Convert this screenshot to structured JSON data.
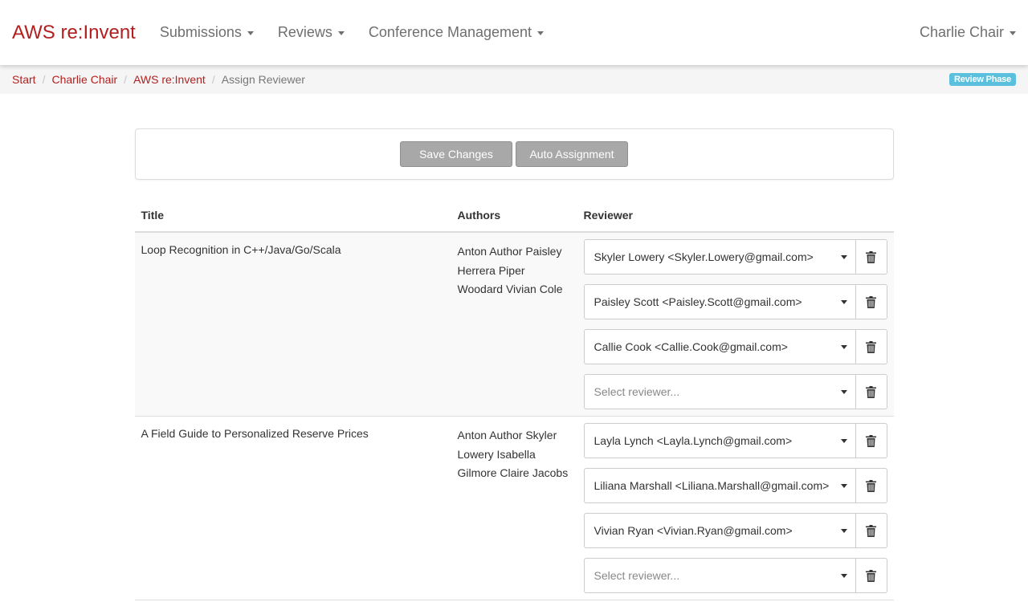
{
  "navbar": {
    "brand": "AWS re:Invent",
    "menus": [
      "Submissions",
      "Reviews",
      "Conference Management"
    ],
    "user": "Charlie Chair"
  },
  "breadcrumb": {
    "items": [
      "Start",
      "Charlie Chair",
      "AWS re:Invent"
    ],
    "active": "Assign Reviewer",
    "phase_badge": "Review Phase"
  },
  "toolbar": {
    "save_label": "Save Changes",
    "auto_label": "Auto Assignment"
  },
  "table": {
    "headers": {
      "title": "Title",
      "authors": "Authors",
      "reviewer": "Reviewer"
    },
    "placeholder": "Select reviewer...",
    "rows": [
      {
        "title": "Loop Recognition in C++/Java/Go/Scala",
        "authors": [
          "Anton Author Paisley",
          "Herrera Piper",
          "Woodard Vivian Cole"
        ],
        "reviewers": [
          "Skyler Lowery <Skyler.Lowery@gmail.com>",
          "Paisley Scott <Paisley.Scott@gmail.com>",
          "Callie Cook <Callie.Cook@gmail.com>",
          ""
        ]
      },
      {
        "title": "A Field Guide to Personalized Reserve Prices",
        "authors": [
          "Anton Author Skyler",
          "Lowery Isabella",
          "Gilmore Claire Jacobs"
        ],
        "reviewers": [
          "Layla Lynch <Layla.Lynch@gmail.com>",
          "Liliana Marshall <Liliana.Marshall@gmail.com>",
          "Vivian Ryan <Vivian.Ryan@gmail.com>",
          ""
        ]
      }
    ]
  },
  "colors": {
    "brand": "#b31f1f",
    "badge": "#5bc0de",
    "button": "#a8a8a8"
  },
  "icons": {
    "delete": "trash-icon",
    "dropdown": "chevron-down-icon"
  }
}
